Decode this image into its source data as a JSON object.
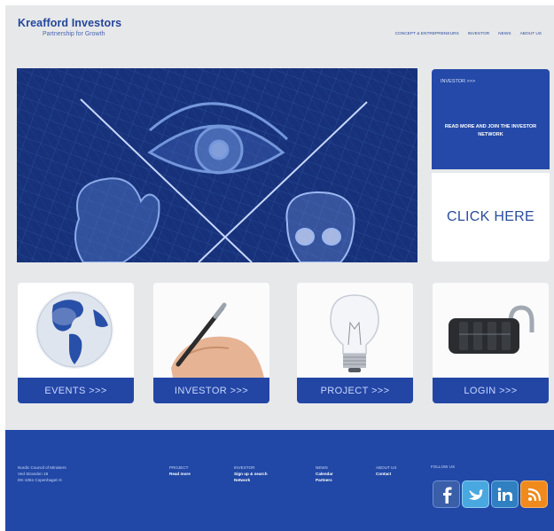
{
  "header": {
    "brand_name": "Kreafford Investors",
    "tagline": "Partnership for Growth",
    "nav": [
      "Concept & Entrepreneurs",
      "Investor",
      "News",
      "About Us"
    ]
  },
  "investor_panel": {
    "title": "Investor >>>",
    "text": "Read more and join the investor network",
    "cta": "CLICK HERE"
  },
  "cards": [
    {
      "label": "EVENTS >>>",
      "icon": "globe-icon"
    },
    {
      "label": "INVESTOR >>>",
      "icon": "pen-hand-icon"
    },
    {
      "label": "PROJECT >>>",
      "icon": "lightbulb-icon"
    },
    {
      "label": "LOGIN >>>",
      "icon": "padlock-icon"
    }
  ],
  "footer": {
    "address": [
      "Nordic Council of Ministers",
      "Ved Stranden 18",
      "DK-1061 Copenhagen K"
    ],
    "columns": [
      {
        "heading": "Project",
        "links": [
          "Read more"
        ]
      },
      {
        "heading": "Investor",
        "links": [
          "Sign up & search",
          "Network"
        ]
      },
      {
        "heading": "News",
        "links": [
          "Calendar",
          "Partners"
        ]
      },
      {
        "heading": "About us",
        "links": [
          "Contact"
        ]
      }
    ],
    "follow_label": "Follow us",
    "social": [
      "facebook-icon",
      "twitter-icon",
      "linkedin-icon",
      "rss-icon"
    ]
  },
  "colors": {
    "brand_blue": "#2148a6",
    "page_bg": "#e7e8ea",
    "hero_blue": "#18347c"
  }
}
